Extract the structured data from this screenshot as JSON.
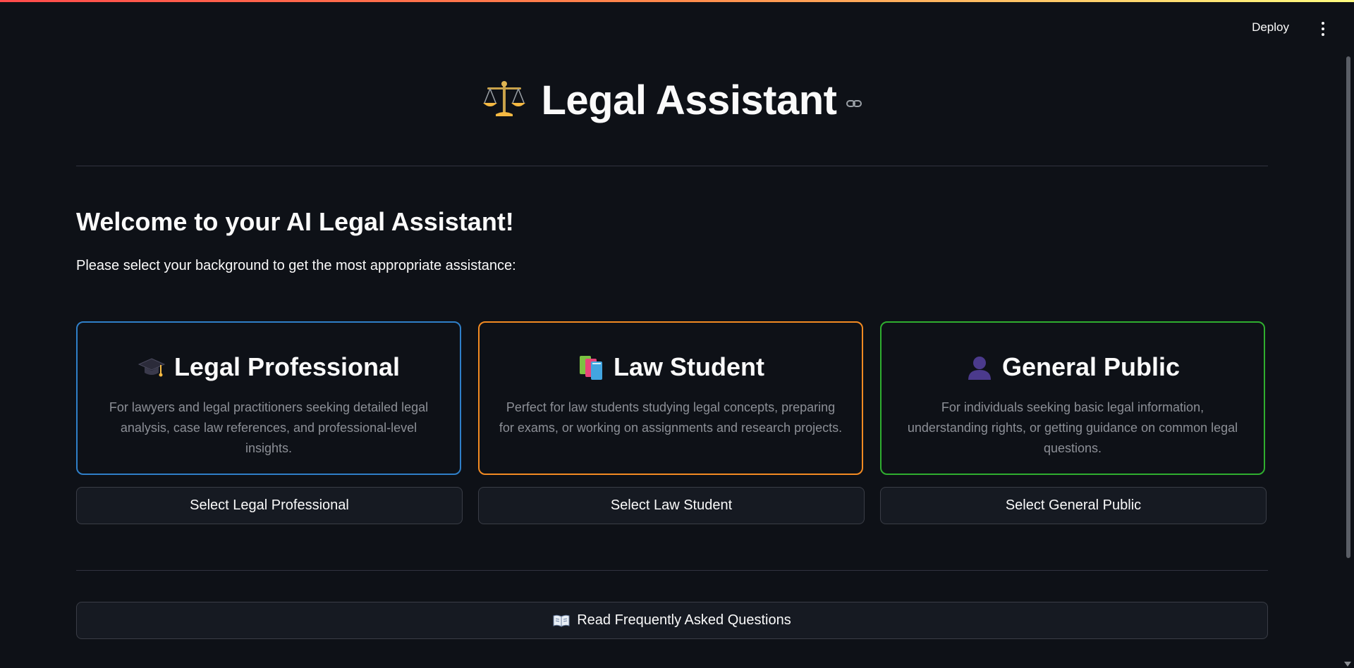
{
  "header": {
    "deploy_label": "Deploy",
    "menu_icon": "kebab-menu-icon"
  },
  "title": {
    "icon": "balance-scale-icon",
    "text": "Legal Assistant",
    "anchor_icon": "link-icon"
  },
  "welcome": {
    "heading": "Welcome to your AI Legal Assistant!",
    "subtitle": "Please select your background to get the most appropriate assistance:"
  },
  "cards": [
    {
      "icon": "graduation-cap-icon",
      "title": "Legal Professional",
      "description": "For lawyers and legal practitioners seeking detailed legal analysis, case law references, and professional-level insights.",
      "border_color": "#2f7fc8",
      "button_label": "Select Legal Professional"
    },
    {
      "icon": "books-icon",
      "title": "Law Student",
      "description": "Perfect for law students studying legal concepts, preparing for exams, or working on assignments and research projects.",
      "border_color": "#f28a22",
      "button_label": "Select Law Student"
    },
    {
      "icon": "person-silhouette-icon",
      "title": "General Public",
      "description": "For individuals seeking basic legal information, understanding rights, or getting guidance on common legal questions.",
      "border_color": "#2fae2f",
      "button_label": "Select General Public"
    }
  ],
  "faq": {
    "icon": "open-book-icon",
    "label": "Read Frequently Asked Questions"
  },
  "colors": {
    "background": "#0e1117",
    "text": "#fafafa",
    "muted_text": "#8c8f96",
    "button_bg": "#161a22",
    "button_border": "#3a3d46"
  }
}
